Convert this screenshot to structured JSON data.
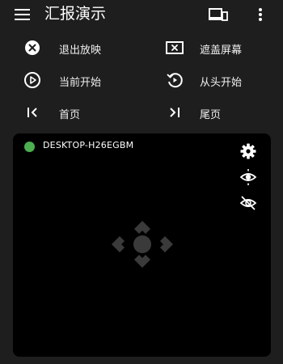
{
  "app": {
    "title": "汇报演示"
  },
  "icons": {
    "menu": "menu-icon",
    "device": "device-icon",
    "more": "more-vert-icon"
  },
  "actions": [
    {
      "label": "退出放映",
      "icon": "close-circle-icon"
    },
    {
      "label": "遮盖屏幕",
      "icon": "cover-screen-icon"
    },
    {
      "label": "当前开始",
      "icon": "play-circle-icon"
    },
    {
      "label": "从头开始",
      "icon": "restart-icon"
    },
    {
      "label": "首页",
      "icon": "first-page-icon"
    },
    {
      "label": "尾页",
      "icon": "last-page-icon"
    }
  ],
  "preview": {
    "device_name": "DESKTOP-H26EGBM",
    "status_color": "#4caf50",
    "side_buttons": [
      "settings-icon",
      "eye-icon",
      "eye-off-icon"
    ],
    "controller": "dpad-icon"
  },
  "colors": {
    "background": "#1e1e1e",
    "panel": "#000000",
    "text": "#ffffff",
    "status": "#4caf50"
  }
}
